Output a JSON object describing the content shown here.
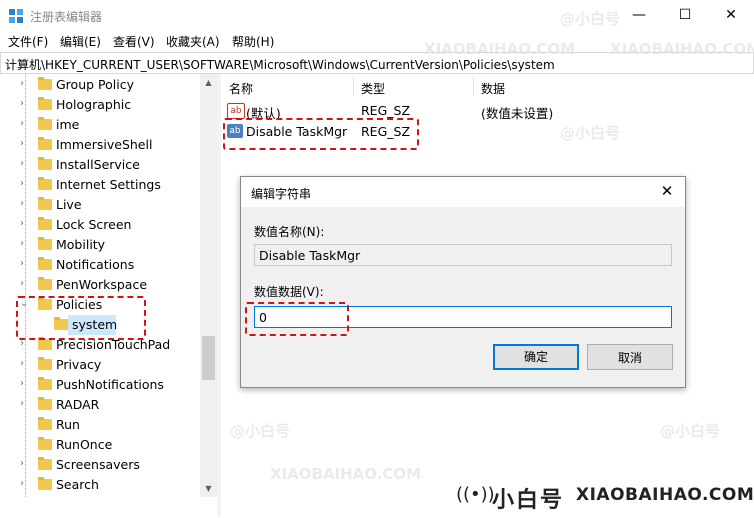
{
  "window": {
    "title": "注册表编辑器",
    "minimize_glyph": "—",
    "maximize_glyph": "☐",
    "close_glyph": "✕"
  },
  "menu": [
    "文件(F)",
    "编辑(E)",
    "查看(V)",
    "收藏夹(A)",
    "帮助(H)"
  ],
  "address": "计算机\\HKEY_CURRENT_USER\\SOFTWARE\\Microsoft\\Windows\\CurrentVersion\\Policies\\system",
  "tree": {
    "items": [
      {
        "label": "Group Policy",
        "arrow": "›"
      },
      {
        "label": "Holographic",
        "arrow": "›"
      },
      {
        "label": "ime",
        "arrow": "›"
      },
      {
        "label": "ImmersiveShell",
        "arrow": "›"
      },
      {
        "label": "InstallService",
        "arrow": "›"
      },
      {
        "label": "Internet Settings",
        "arrow": "›"
      },
      {
        "label": "Live",
        "arrow": "›"
      },
      {
        "label": "Lock Screen",
        "arrow": "›"
      },
      {
        "label": "Mobility",
        "arrow": "›"
      },
      {
        "label": "Notifications",
        "arrow": "›"
      },
      {
        "label": "PenWorkspace",
        "arrow": "›"
      },
      {
        "label": "Policies",
        "arrow": "⌄"
      },
      {
        "label": "system",
        "arrow": ""
      },
      {
        "label": "PrecisionTouchPad",
        "arrow": "›"
      },
      {
        "label": "Privacy",
        "arrow": "›"
      },
      {
        "label": "PushNotifications",
        "arrow": "›"
      },
      {
        "label": "RADAR",
        "arrow": "›"
      },
      {
        "label": "Run",
        "arrow": ""
      },
      {
        "label": "RunOnce",
        "arrow": ""
      },
      {
        "label": "Screensavers",
        "arrow": "›"
      },
      {
        "label": "Search",
        "arrow": "›"
      }
    ]
  },
  "list": {
    "headers": {
      "name": "名称",
      "type": "类型",
      "data": "数据"
    },
    "rows": [
      {
        "name": "(默认)",
        "type": "REG_SZ",
        "data": "(数值未设置)",
        "icon": "ab"
      },
      {
        "name": "Disable TaskMgr",
        "type": "REG_SZ",
        "data": "",
        "icon": "ab"
      }
    ]
  },
  "dialog": {
    "title": "编辑字符串",
    "close_glyph": "✕",
    "name_label": "数值名称(N):",
    "name_value": "Disable TaskMgr",
    "data_label": "数值数据(V):",
    "data_value": "0",
    "ok": "确定",
    "cancel": "取消"
  },
  "watermark": {
    "cn": "@小白号",
    "en": "XIAOBAIHAO.COM"
  },
  "brand": {
    "icon": "((•))",
    "cn": "小白号",
    "en": "XIAOBAIHAO.COM"
  },
  "colors": {
    "highlight": "#d0121a",
    "selection": "#cce8ff",
    "folder": "#f3c74f",
    "accent": "#0078d7"
  }
}
